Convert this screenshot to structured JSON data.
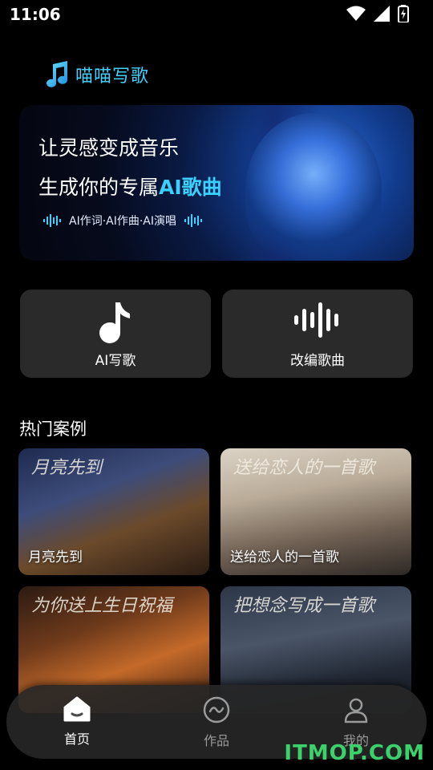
{
  "status_bar": {
    "time": "11:06"
  },
  "brand": {
    "title": "喵喵写歌"
  },
  "banner": {
    "line1": "让灵感变成音乐",
    "line2_prefix": "生成你的专属",
    "line2_highlight": "AI歌曲",
    "subtitle": "AI作词·AI作曲·AI演唱"
  },
  "features": [
    {
      "label": "AI写歌",
      "icon": "music-note-icon"
    },
    {
      "label": "改编歌曲",
      "icon": "sound-wave-icon"
    }
  ],
  "section": {
    "title": "热门案例"
  },
  "cases": [
    {
      "label": "月亮先到",
      "handwriting": "月亮先到"
    },
    {
      "label": "送给恋人的一首歌",
      "handwriting": "送给恋人的一首歌"
    },
    {
      "label": "",
      "handwriting": "为你送上生日祝福"
    },
    {
      "label": "",
      "handwriting": "把想念写成一首歌"
    }
  ],
  "bottom_nav": {
    "items": [
      {
        "label": "首页",
        "icon": "home-icon",
        "active": true
      },
      {
        "label": "作品",
        "icon": "works-icon",
        "active": false
      },
      {
        "label": "我的",
        "icon": "profile-icon",
        "active": false
      }
    ]
  },
  "watermark": "ITMOP.COM",
  "colors": {
    "accent": "#3ad1ff",
    "background": "#000000",
    "card": "#2a2a2a",
    "nav_inactive": "#9a9a9a"
  }
}
